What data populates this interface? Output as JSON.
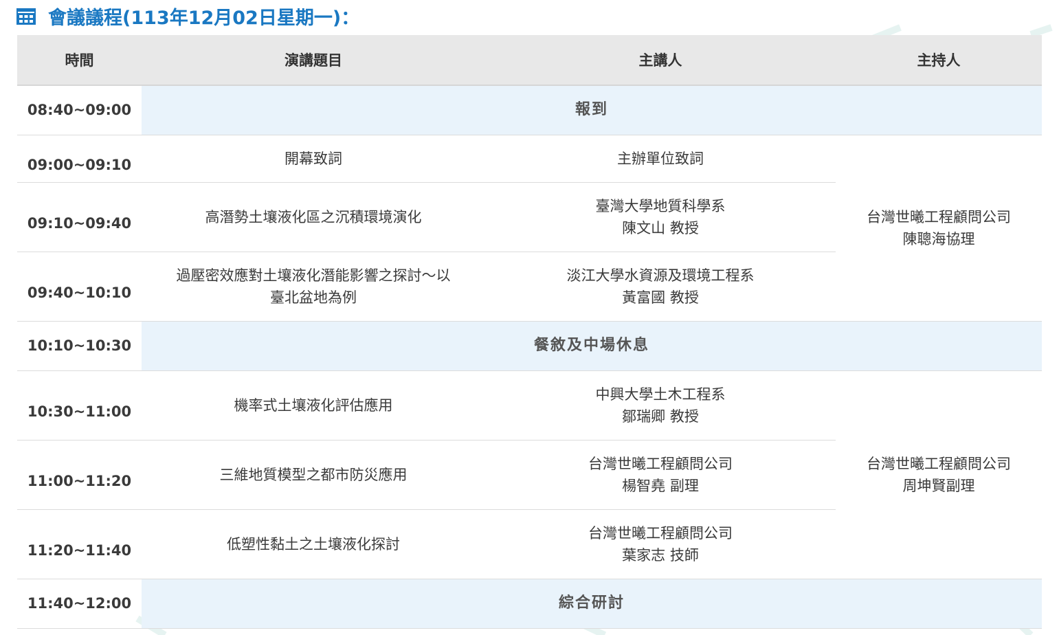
{
  "heading": {
    "icon": "calendar-table-icon",
    "text": "會議議程(113年12月02日星期一)："
  },
  "colors": {
    "accent": "#1a78c2",
    "header_bg": "#e8e8e8",
    "break_bg": "#e9f3fb"
  },
  "table": {
    "headers": {
      "time": "時間",
      "topic": "演講題目",
      "speaker": "主講人",
      "host": "主持人"
    },
    "rows": {
      "r1": {
        "time": "08:40~09:00",
        "label": "報到"
      },
      "r2": {
        "time": "09:00~09:10",
        "topic": "開幕致詞",
        "speaker": "主辦單位致詞"
      },
      "r3": {
        "time": "09:10~09:40",
        "topic": "高潛勢土壤液化區之沉積環境演化",
        "speaker_org": "臺灣大學地質科學系",
        "speaker_name": "陳文山 教授"
      },
      "r4": {
        "time": "09:40~10:10",
        "topic_line1": "過壓密效應對土壤液化潛能影響之探討～以",
        "topic_line2": "臺北盆地為例",
        "speaker_org": "淡江大學水資源及環境工程系",
        "speaker_name": "黃富國 教授"
      },
      "r5": {
        "time": "10:10~10:30",
        "label": "餐敘及中場休息"
      },
      "r6": {
        "time": "10:30~11:00",
        "topic": "機率式土壤液化評估應用",
        "speaker_org": "中興大學土木工程系",
        "speaker_name": "鄒瑞卿 教授"
      },
      "r7": {
        "time": "11:00~11:20",
        "topic": "三維地質模型之都市防災應用",
        "speaker_org": "台灣世曦工程顧問公司",
        "speaker_name": "楊智堯 副理"
      },
      "r8": {
        "time": "11:20~11:40",
        "topic": "低塑性黏土之土壤液化探討",
        "speaker_org": "台灣世曦工程顧問公司",
        "speaker_name": "葉家志 技師"
      },
      "r9": {
        "time": "11:40~12:00",
        "label": "綜合研討"
      }
    },
    "hosts": {
      "h1_org": "台灣世曦工程顧問公司",
      "h1_name": "陳聰海協理",
      "h2_org": "台灣世曦工程顧問公司",
      "h2_name": "周坤賢副理"
    }
  }
}
